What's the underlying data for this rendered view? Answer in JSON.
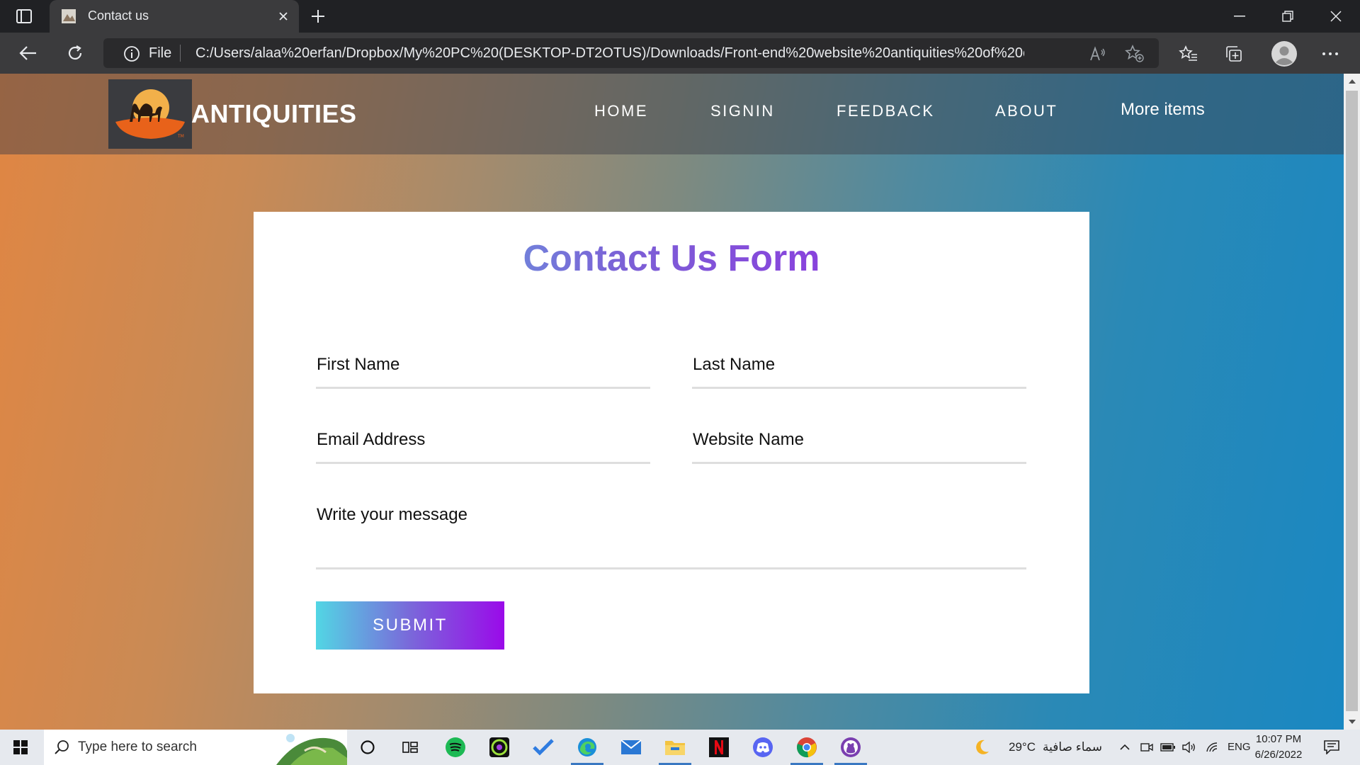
{
  "browser": {
    "tab_title": "Contact us",
    "address_scheme": "File",
    "url": "C:/Users/alaa%20erfan/Dropbox/My%20PC%20(DESKTOP-DT2OTUS)/Downloads/Front-end%20website%20antiquities%20of%20egypt..."
  },
  "site": {
    "logo_text": "ANTIQUITIES",
    "nav": [
      "HOME",
      "SIGNIN",
      "FEEDBACK",
      "ABOUT"
    ],
    "nav_more": "More items"
  },
  "form": {
    "title": "Contact Us Form",
    "fields": {
      "first_name": "First Name",
      "last_name": "Last Name",
      "email": "Email Address",
      "website": "Website Name",
      "message": "Write your message"
    },
    "submit_label": "SUBMIT"
  },
  "taskbar": {
    "search_placeholder": "Type here to search",
    "weather_temp": "29°C",
    "weather_desc": "سماء صافية",
    "language": "ENG",
    "time": "10:07 PM",
    "date": "6/26/2022"
  },
  "colors": {
    "gradient_start": "#52d6e4",
    "gradient_end": "#9a0ae9",
    "page_left": "#e08643",
    "page_right": "#1a88c2"
  }
}
